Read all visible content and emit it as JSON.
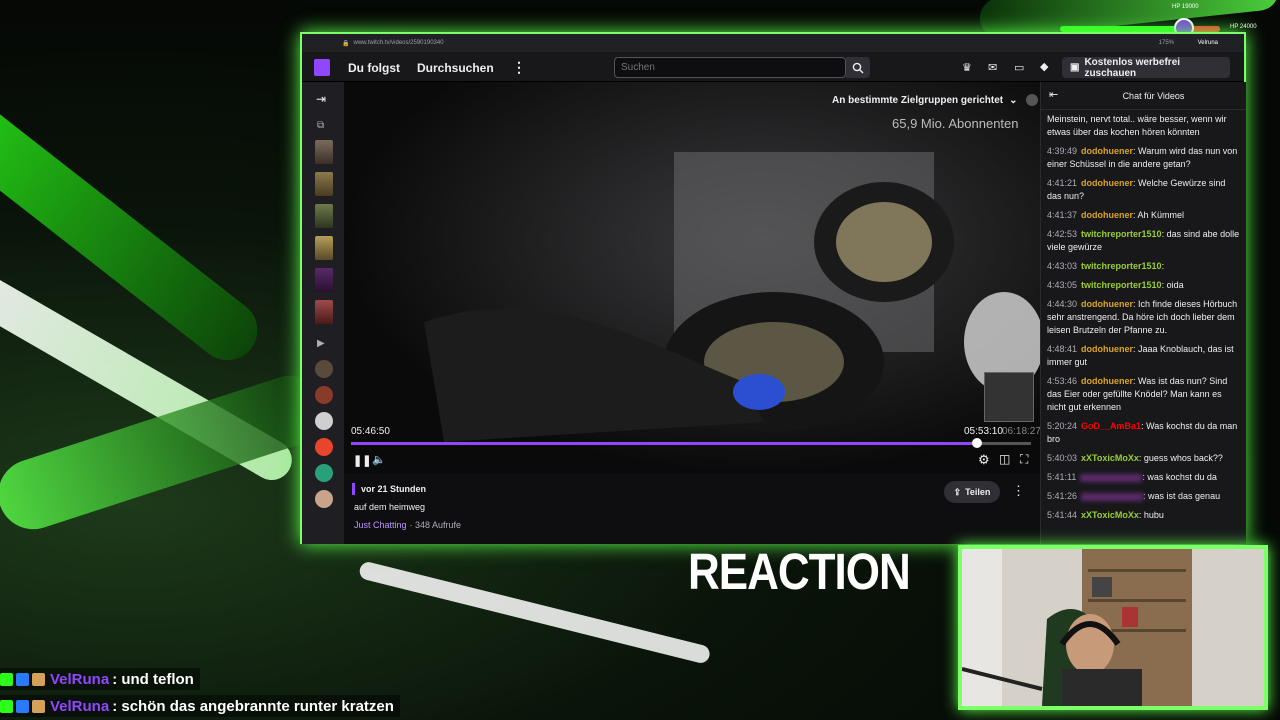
{
  "browser": {
    "url": "www.twitch.tv/videos/2590190340",
    "zoom": "175%",
    "profile_name": "Velruna"
  },
  "stream_overlay": {
    "hp_left": "HP 19000",
    "hp_right": "HP 24000",
    "reaction_title": "REACTION"
  },
  "nav": {
    "following": "Du folgst",
    "browse": "Durchsuchen",
    "search_placeholder": "Suchen",
    "turbo": "Kostenlos werbefrei zuschauen"
  },
  "player": {
    "ad_targeting": "An bestimmte Zielgruppen gerichtet",
    "subscribers": "65,9 Mio. Abonnenten",
    "current_time": "05:46:50",
    "hover_time": "05:53:10",
    "end_time": "06:18:27",
    "progress": 0.92
  },
  "video_info": {
    "age": "vor 21 Stunden",
    "title": "auf dem heimweg",
    "category": "Just Chatting",
    "views": "· 348 Aufrufe",
    "share": "Teilen"
  },
  "chat": {
    "header": "Chat für Videos",
    "messages": [
      {
        "time": "",
        "user": "",
        "text": "Meinstein, nervt total.. wäre besser, wenn wir etwas über das kochen hören könnten",
        "color": "#efeff1"
      },
      {
        "time": "4:39:49",
        "user": "dodohuener",
        "text": ": Warum wird das nun von einer Schüssel in die andere getan?",
        "color": "#daa520"
      },
      {
        "time": "4:41:21",
        "user": "dodohuener",
        "text": ": Welche Gewürze sind das nun?",
        "color": "#daa520"
      },
      {
        "time": "4:41:37",
        "user": "dodohuener",
        "text": ": Ah Kümmel",
        "color": "#daa520"
      },
      {
        "time": "4:42:53",
        "user": "twitchreporter1510",
        "text": ": das sind abe dolle viele gewürze",
        "color": "#9acd32"
      },
      {
        "time": "4:43:03",
        "user": "twitchreporter1510",
        "text": ":",
        "color": "#9acd32"
      },
      {
        "time": "4:43:05",
        "user": "twitchreporter1510",
        "text": ": oida",
        "color": "#9acd32"
      },
      {
        "time": "4:44:30",
        "user": "dodohuener",
        "text": ": Ich finde dieses Hörbuch sehr anstrengend. Da höre ich doch lieber dem leisen Brutzeln der Pfanne zu.",
        "color": "#daa520"
      },
      {
        "time": "4:48:41",
        "user": "dodohuener",
        "text": ": Jaaa Knoblauch, das ist immer gut",
        "color": "#daa520"
      },
      {
        "time": "4:53:46",
        "user": "dodohuener",
        "text": ": Was ist das nun? Sind das Eier oder gefüllte Knödel? Man kann es nicht gut erkennen",
        "color": "#daa520"
      },
      {
        "time": "5:20:24",
        "user": "GoD__AmBa1",
        "text": ": Was kochst du da man bro",
        "color": "#ff0000"
      },
      {
        "time": "5:40:03",
        "user": "xXToxicMoXx",
        "text": ": guess whos back??",
        "color": "#9acd32"
      },
      {
        "time": "5:41:11",
        "user": "",
        "text": ": was kochst du da",
        "color": "#8a2be2"
      },
      {
        "time": "5:41:26",
        "user": "",
        "text": ": was ist das genau",
        "color": "#8a2be2"
      },
      {
        "time": "5:41:44",
        "user": "xXToxicMoXx",
        "text": ": hubu",
        "color": "#9acd32"
      }
    ]
  },
  "overlay_chat": [
    {
      "user": "VelRuna",
      "text": ": und teflon"
    },
    {
      "user": "VelRuna",
      "text": ": schön das angebrannte runter kratzen"
    }
  ],
  "colors": {
    "accent_green": "#7dff6a",
    "twitch_purple": "#9147ff"
  }
}
